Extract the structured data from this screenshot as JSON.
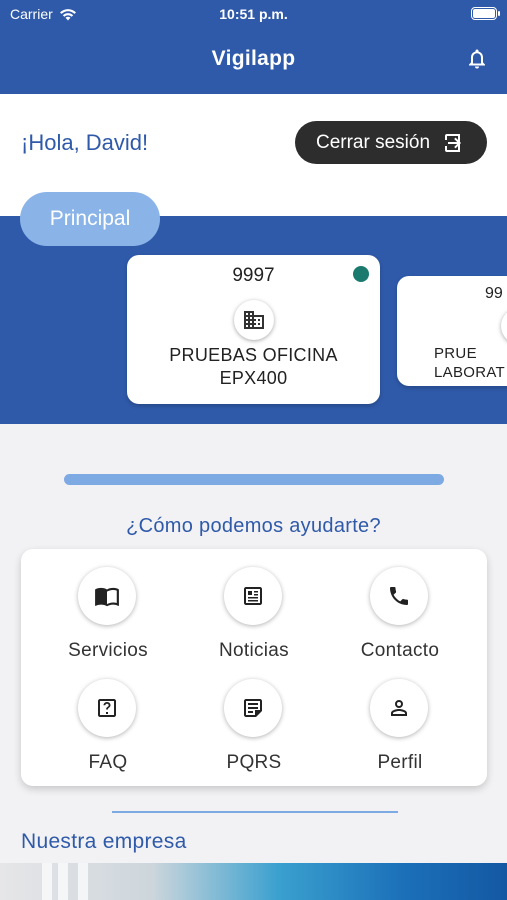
{
  "status": {
    "carrier": "Carrier",
    "time": "10:51 p.m."
  },
  "header": {
    "title": "Vigilapp",
    "bell_icon": "bell-icon"
  },
  "greeting": "¡Hola, David!",
  "logout": {
    "label": "Cerrar sesión",
    "icon": "logout-icon"
  },
  "section_tab": "Principal",
  "cards": [
    {
      "code": "9997",
      "name": "PRUEBAS OFICINA EPX400",
      "icon": "building-icon",
      "status": "online",
      "status_color": "#1a7a6e"
    },
    {
      "code": "99",
      "name": "PRUE LABORAT",
      "icon": "home-icon"
    }
  ],
  "progress": {
    "value": 1.0,
    "color": "#7eaae3"
  },
  "help_title": "¿Cómo podemos ayudarte?",
  "menu": [
    {
      "label": "Servicios",
      "icon": "book-icon"
    },
    {
      "label": "Noticias",
      "icon": "news-icon"
    },
    {
      "label": "Contacto",
      "icon": "phone-icon"
    },
    {
      "label": "FAQ",
      "icon": "question-icon"
    },
    {
      "label": "PQRS",
      "icon": "note-icon"
    },
    {
      "label": "Perfil",
      "icon": "person-icon"
    }
  ],
  "company_title": "Nuestra empresa",
  "colors": {
    "primary": "#2f5aa9",
    "accent": "#8ab4e8",
    "dark": "#2d2d2d"
  }
}
